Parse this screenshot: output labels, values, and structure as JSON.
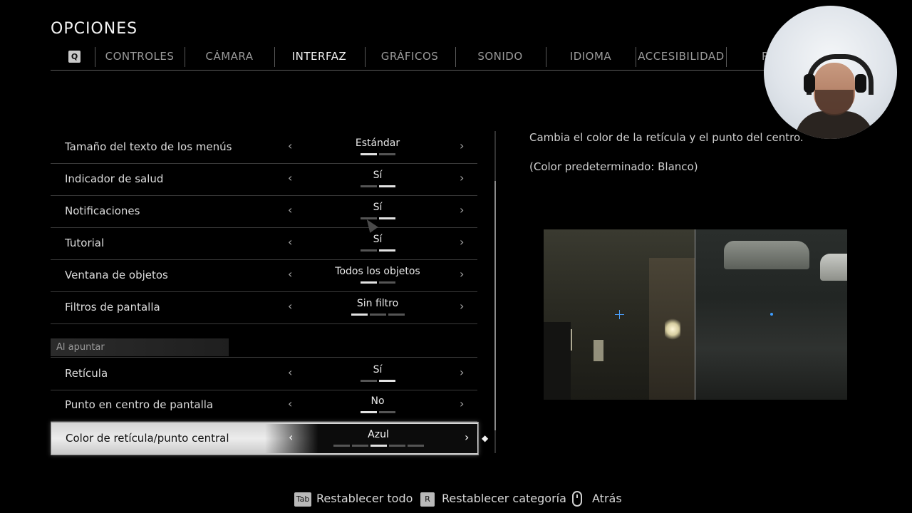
{
  "header": {
    "title": "OPCIONES"
  },
  "tabs": {
    "key_hint": "Q",
    "items": [
      {
        "label": "CONTROLES"
      },
      {
        "label": "CÁMARA"
      },
      {
        "label": "INTERFAZ",
        "active": true
      },
      {
        "label": "GRÁFICOS"
      },
      {
        "label": "SONIDO"
      },
      {
        "label": "IDIOMA"
      },
      {
        "label": "ACCESIBILIDAD"
      },
      {
        "label": "R"
      }
    ]
  },
  "settings": {
    "rows": [
      {
        "label": "Tamaño del texto de los menús",
        "value": "Estándar",
        "steps": 2,
        "selected_index": 0
      },
      {
        "label": "Indicador de salud",
        "value": "Sí",
        "steps": 2,
        "selected_index": 1
      },
      {
        "label": "Notificaciones",
        "value": "Sí",
        "steps": 2,
        "selected_index": 1
      },
      {
        "label": "Tutorial",
        "value": "Sí",
        "steps": 2,
        "selected_index": 1
      },
      {
        "label": "Ventana de objetos",
        "value": "Todos los objetos",
        "steps": 2,
        "selected_index": 0
      },
      {
        "label": "Filtros de pantalla",
        "value": "Sin filtro",
        "steps": 3,
        "selected_index": 0
      }
    ],
    "section": "Al apuntar",
    "aim_rows": [
      {
        "label": "Retícula",
        "value": "Sí",
        "steps": 2,
        "selected_index": 1
      },
      {
        "label": "Punto en centro de pantalla",
        "value": "No",
        "steps": 2,
        "selected_index": 0
      },
      {
        "label": "Color de retícula/punto central",
        "value": "Azul",
        "steps": 5,
        "selected_index": 2,
        "focused": true
      }
    ],
    "arrow_left": "‹",
    "arrow_right": "›"
  },
  "description": {
    "line1": "Cambia el color de la retícula y el punto del centro.",
    "line2": "(Color predeterminado: Blanco)"
  },
  "preview": {
    "reticle_color": "#4aa0ff"
  },
  "footer": {
    "reset_all_key": "Tab",
    "reset_all": "Restablecer todo",
    "reset_category_key": "R",
    "reset_category": "Restablecer categoría",
    "back": "Atrás"
  }
}
